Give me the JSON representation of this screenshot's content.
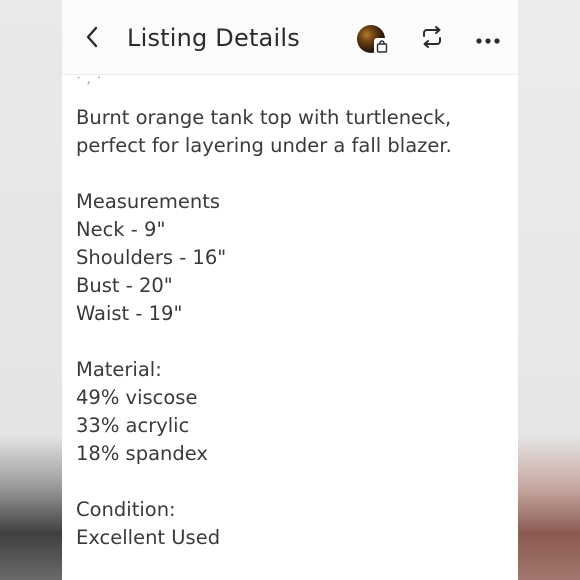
{
  "header": {
    "title": "Listing Details"
  },
  "peek_text": "· , ·",
  "description": {
    "lines": [
      "Burnt orange tank top with turtleneck,",
      "perfect for layering under a fall blazer."
    ]
  },
  "measurements": {
    "heading": "Measurements",
    "items": [
      "Neck - 9\"",
      "Shoulders - 16\"",
      "Bust - 20\"",
      "Waist - 19\""
    ]
  },
  "material": {
    "heading": "Material:",
    "items": [
      "49% viscose",
      "33% acrylic",
      "18% spandex"
    ]
  },
  "condition": {
    "heading": "Condition:",
    "value": "Excellent Used"
  },
  "icons": {
    "back": "chevron-left-icon",
    "avatar": "user-avatar",
    "bag": "shopping-bag-icon",
    "share": "repost-icon",
    "more": "more-dots-icon"
  },
  "colors": {
    "text": "#3a3a3a",
    "title": "#2b2b2b",
    "header_bg": "#fbfbfb"
  }
}
